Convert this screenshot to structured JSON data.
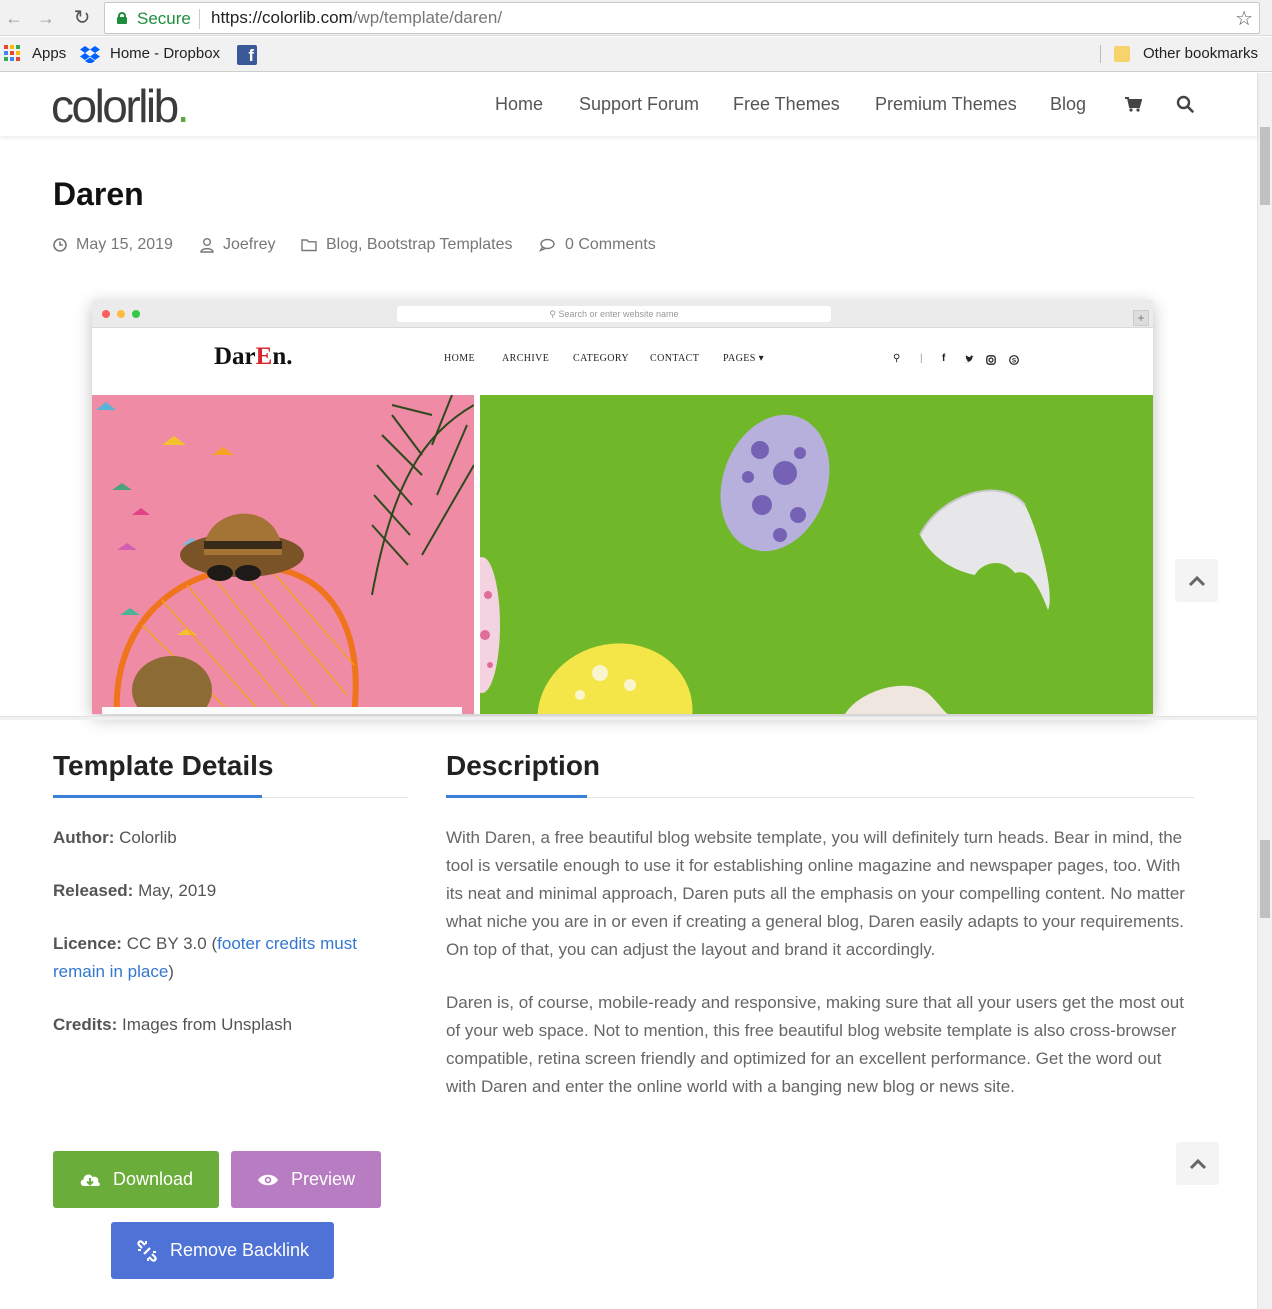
{
  "browser": {
    "secure_label": "Secure",
    "url_host": "https://colorlib.com",
    "url_path": "/wp/template/daren/",
    "bookmarks": {
      "apps": "Apps",
      "dropbox": "Home - Dropbox",
      "other": "Other bookmarks"
    }
  },
  "site": {
    "logo_text": "colorlib",
    "logo_dot": ".",
    "nav": [
      "Home",
      "Support Forum",
      "Free Themes",
      "Premium Themes",
      "Blog"
    ]
  },
  "post": {
    "title": "Daren",
    "date": "May 15, 2019",
    "author": "Joefrey",
    "categories": "Blog, Bootstrap Templates",
    "comments": "0 Comments"
  },
  "mockup": {
    "address_placeholder": "Search or enter website name",
    "logo_main": "Dar",
    "logo_accent": "E",
    "logo_end": "n.",
    "nav": [
      "HOME",
      "ARCHIVE",
      "CATEGORY",
      "CONTACT",
      "PAGES"
    ]
  },
  "details": {
    "heading": "Template Details",
    "author_label": "Author:",
    "author_value": "Colorlib",
    "released_label": "Released:",
    "released_value": "May, 2019",
    "licence_label": "Licence:",
    "licence_value": "CC BY 3.0",
    "licence_open": "(",
    "licence_link_1": "footer credits must",
    "licence_link_2": "remain in place",
    "licence_close": ")",
    "credits_label": "Credits:",
    "credits_value": "Images from Unsplash"
  },
  "description": {
    "heading": "Description",
    "paragraphs": [
      "With Daren, a free beautiful blog website template, you will definitely turn heads. Bear in mind, the tool is versatile enough to use it for establishing online magazine and newspaper pages, too. With its neat and minimal approach, Daren puts all the emphasis on your compelling content. No matter what niche you are in or even if creating a general blog, Daren easily adapts to your requirements. On top of that, you can adjust the layout and brand it accordingly.",
      "Daren is, of course, mobile-ready and responsive, making sure that all your users get the most out of your web space. Not to mention, this free beautiful blog website template is also cross-browser compatible, retina screen friendly and optimized for an excellent performance. Get the word out with Daren and enter the online world with a banging new blog or news site."
    ]
  },
  "buttons": {
    "download": "Download",
    "preview": "Preview",
    "remove_backlink": "Remove Backlink"
  },
  "colors": {
    "download": "#6aad3a",
    "preview": "#b77cc1",
    "remove_backlink": "#4f72d6",
    "accent": "#3b7fd6",
    "secure": "#1e8e3e"
  }
}
